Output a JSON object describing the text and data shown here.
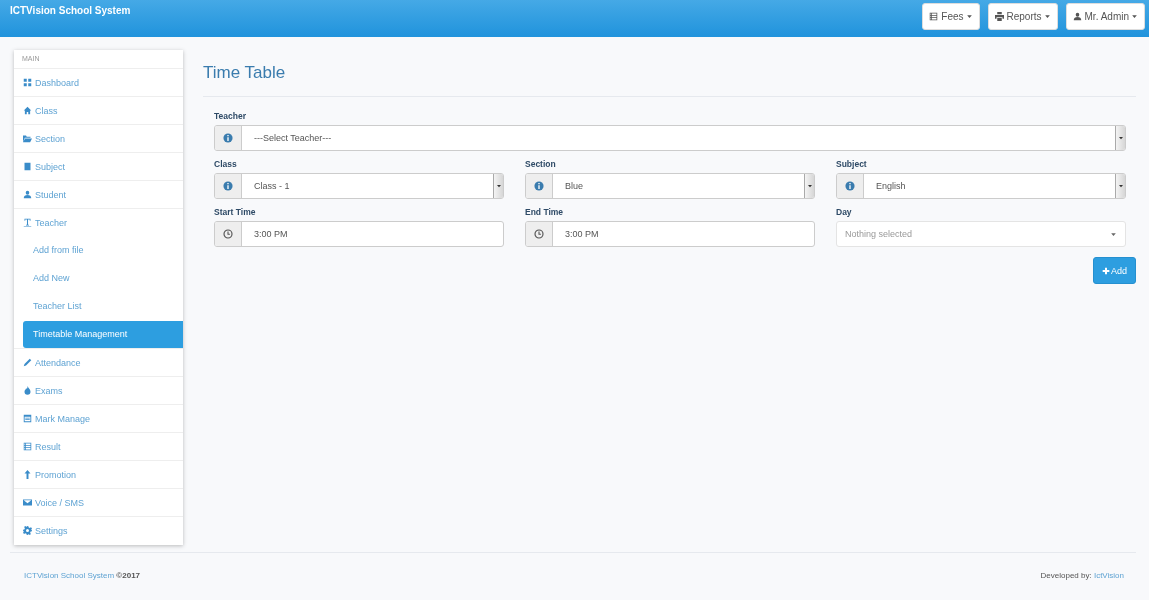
{
  "app_title": "ICTVision School System",
  "nav_buttons": [
    {
      "label": "Fees"
    },
    {
      "label": "Reports"
    },
    {
      "label": "Mr. Admin"
    }
  ],
  "sidebar": {
    "heading": "MAIN",
    "items": [
      {
        "label": "Dashboard",
        "selected": false
      },
      {
        "label": "Class",
        "selected": false
      },
      {
        "label": "Section",
        "selected": false
      },
      {
        "label": "Subject",
        "selected": false
      },
      {
        "label": "Student",
        "selected": false
      },
      {
        "label": "Teacher",
        "selected": false,
        "children": [
          {
            "label": "Add from file",
            "selected": false
          },
          {
            "label": "Add New",
            "selected": false
          },
          {
            "label": "Teacher List",
            "selected": false
          },
          {
            "label": "Timetable Management",
            "selected": true
          }
        ]
      },
      {
        "label": "Attendance",
        "selected": false
      },
      {
        "label": "Exams",
        "selected": false
      },
      {
        "label": "Mark Manage",
        "selected": false
      },
      {
        "label": "Result",
        "selected": false
      },
      {
        "label": "Promotion",
        "selected": false
      },
      {
        "label": "Voice / SMS",
        "selected": false
      },
      {
        "label": "Settings",
        "selected": false
      }
    ]
  },
  "page_title": "Time Table",
  "form_rows": [
    [
      {
        "label": "Teacher",
        "kind": "select",
        "value": "---Select Teacher---"
      }
    ],
    [
      {
        "label": "Class",
        "kind": "select",
        "value": "Class - 1"
      },
      {
        "label": "Section",
        "kind": "select",
        "value": "Blue"
      },
      {
        "label": "Subject",
        "kind": "select",
        "value": "English"
      }
    ],
    [
      {
        "label": "Start Time",
        "kind": "time",
        "value": "3:00 PM"
      },
      {
        "label": "End Time",
        "kind": "time",
        "value": "3:00 PM"
      },
      {
        "label": "Day",
        "kind": "multiselect",
        "placeholder": "Nothing selected"
      }
    ]
  ],
  "add_button": {
    "label": "Add"
  },
  "footer": {
    "app_link": "ICTVision School System",
    "year": "©2017",
    "credit_label": "Developed by:",
    "credit_link": "IctVision"
  }
}
